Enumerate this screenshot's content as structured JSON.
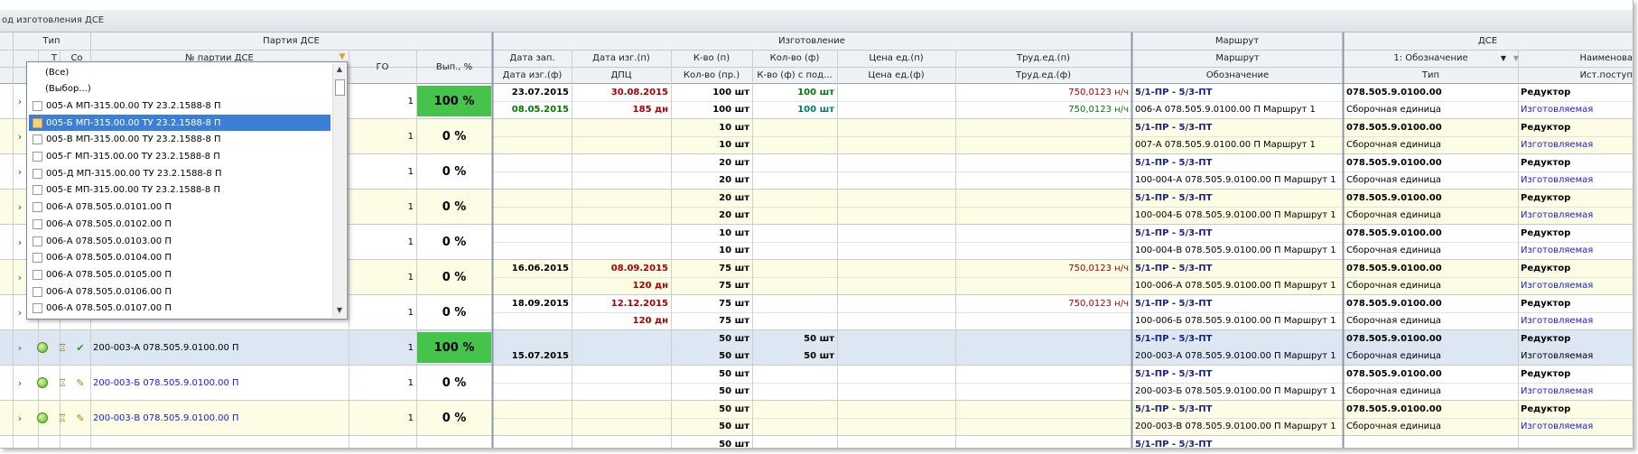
{
  "group_panel": {
    "text": "од изготовления ДСЕ"
  },
  "header": {
    "band_type": "Тип",
    "band_partiya": "Партия ДСЕ",
    "band_izg": "Изготовление",
    "band_marshrut": "Маршрут",
    "band_dse": "ДСЕ",
    "col_t": "Т",
    "col_so": "Со",
    "col_nomer": "№ партии ДСЕ",
    "col_go": "ГО",
    "col_vyp": "Вып., %",
    "r1": [
      "Дата зап.",
      "Дата изг.(п)",
      "К-во (п)",
      "Кол-во (ф)",
      "Цена ед.(п)",
      "Труд.ед.(п)",
      "Маршрут",
      "1: Обозначение",
      "Наименова"
    ],
    "r2": [
      "Дата изг.(ф)",
      "ДПЦ",
      "Кол-во (пр.)",
      "К-во (ф) с под...",
      "Цена ед.(ф)",
      "Труд.ед.(ф)",
      "Обозначение",
      "Тип",
      "Ист.поступ"
    ]
  },
  "dropdown": {
    "items": [
      "(Все)",
      "(Выбор...)",
      "005-А МП-315.00.00 ТУ 23.2.1588-8 П",
      "005-Б МП-315.00.00 ТУ 23.2.1588-8 П",
      "005-В МП-315.00.00 ТУ 23.2.1588-8 П",
      "005-Г МП-315.00.00 ТУ 23.2.1588-8 П",
      "005-Д МП-315.00.00 ТУ 23.2.1588-8 П",
      "005-Е МП-315.00.00 ТУ 23.2.1588-8 П",
      "006-А 078.505.0.0101.00 П",
      "006-А 078.505.0.0102.00 П",
      "006-А 078.505.0.0103.00 П",
      "006-А 078.505.0.0104.00 П",
      "006-А 078.505.0.0105.00 П",
      "006-А 078.505.0.0106.00 П",
      "006-А 078.505.0.0107.00 П"
    ],
    "selected_index": 3
  },
  "rows": [
    {
      "party": "",
      "go": "1",
      "vyp": "100 %",
      "done": true,
      "date_zap": "23.07.2015",
      "date_izg_p": "30.08.2015",
      "kvo_p": "100 шт",
      "kvo_f": "100 шт",
      "trud_p": "750,0123 н/ч",
      "marshrut": "5/1-ПР - 5/3-ПТ",
      "oboz": "078.505.9.0100.00",
      "naim": "Редуктор",
      "date_izg_f": "08.05.2015",
      "dpc": "185 дн",
      "kvo_pr": "100 шт",
      "kvo_fp": "100 шт",
      "trud_f": "750,0123 н/ч",
      "marshrut_oboz": "006-А 078.505.9.0100.00 П Маршрут 1",
      "tip": "Сборочная единица",
      "ist": "Изготовляемая"
    },
    {
      "party": "",
      "go": "1",
      "vyp": "0 %",
      "done": false,
      "date_zap": "",
      "date_izg_p": "",
      "kvo_p": "10 шт",
      "kvo_f": "",
      "trud_p": "",
      "marshrut": "5/1-ПР - 5/3-ПТ",
      "oboz": "078.505.9.0100.00",
      "naim": "Редуктор",
      "date_izg_f": "",
      "dpc": "",
      "kvo_pr": "10 шт",
      "kvo_fp": "",
      "trud_f": "",
      "marshrut_oboz": "007-А 078.505.9.0100.00 П Маршрут 1",
      "tip": "Сборочная единица",
      "ist": "Изготовляемая"
    },
    {
      "party": "",
      "go": "1",
      "vyp": "0 %",
      "done": false,
      "date_zap": "",
      "date_izg_p": "",
      "kvo_p": "20 шт",
      "kvo_f": "",
      "trud_p": "",
      "marshrut": "5/1-ПР - 5/3-ПТ",
      "oboz": "078.505.9.0100.00",
      "naim": "Редуктор",
      "date_izg_f": "",
      "dpc": "",
      "kvo_pr": "20 шт",
      "kvo_fp": "",
      "trud_f": "",
      "marshrut_oboz": "100-004-А 078.505.9.0100.00 П Маршрут 1",
      "tip": "Сборочная единица",
      "ist": "Изготовляемая"
    },
    {
      "party": "",
      "go": "1",
      "vyp": "0 %",
      "done": false,
      "date_zap": "",
      "date_izg_p": "",
      "kvo_p": "20 шт",
      "kvo_f": "",
      "trud_p": "",
      "marshrut": "5/1-ПР - 5/3-ПТ",
      "oboz": "078.505.9.0100.00",
      "naim": "Редуктор",
      "date_izg_f": "",
      "dpc": "",
      "kvo_pr": "20 шт",
      "kvo_fp": "",
      "trud_f": "",
      "marshrut_oboz": "100-004-Б 078.505.9.0100.00 П Маршрут 1",
      "tip": "Сборочная единица",
      "ist": "Изготовляемая"
    },
    {
      "party": "",
      "go": "1",
      "vyp": "0 %",
      "done": false,
      "date_zap": "",
      "date_izg_p": "",
      "kvo_p": "10 шт",
      "kvo_f": "",
      "trud_p": "",
      "marshrut": "5/1-ПР - 5/3-ПТ",
      "oboz": "078.505.9.0100.00",
      "naim": "Редуктор",
      "date_izg_f": "",
      "dpc": "",
      "kvo_pr": "10 шт",
      "kvo_fp": "",
      "trud_f": "",
      "marshrut_oboz": "100-004-В 078.505.9.0100.00 П Маршрут 1",
      "tip": "Сборочная единица",
      "ist": "Изготовляемая"
    },
    {
      "party": "",
      "go": "1",
      "vyp": "0 %",
      "done": false,
      "date_zap": "16.06.2015",
      "date_izg_p": "08.09.2015",
      "kvo_p": "75 шт",
      "kvo_f": "",
      "trud_p": "750,0123 н/ч",
      "marshrut": "5/1-ПР - 5/3-ПТ",
      "oboz": "078.505.9.0100.00",
      "naim": "Редуктор",
      "date_izg_f": "",
      "dpc": "120 дн",
      "kvo_pr": "75 шт",
      "kvo_fp": "",
      "trud_f": "",
      "marshrut_oboz": "100-006-А 078.505.9.0100.00 П Маршрут 1",
      "tip": "Сборочная единица",
      "ist": "Изготовляемая"
    },
    {
      "party": "",
      "go": "1",
      "vyp": "0 %",
      "done": false,
      "date_zap": "18.09.2015",
      "date_izg_p": "12.12.2015",
      "kvo_p": "75 шт",
      "kvo_f": "",
      "trud_p": "750,0123 н/ч",
      "marshrut": "5/1-ПР - 5/3-ПТ",
      "oboz": "078.505.9.0100.00",
      "naim": "Редуктор",
      "date_izg_f": "",
      "dpc": "120 дн",
      "kvo_pr": "75 шт",
      "kvo_fp": "",
      "trud_f": "",
      "marshrut_oboz": "100-006-Б 078.505.9.0100.00 П Маршрут 1",
      "tip": "Сборочная единица",
      "ist": "Изготовляемая"
    },
    {
      "party": "200-003-А 078.505.9.0100.00 П",
      "go": "1",
      "vyp": "100 %",
      "done": true,
      "date_zap": "",
      "date_izg_p": "",
      "kvo_p": "50 шт",
      "kvo_f": "50 шт",
      "trud_p": "",
      "marshrut": "5/1-ПР - 5/3-ПТ",
      "oboz": "078.505.9.0100.00",
      "naim": "Редуктор",
      "date_izg_f": "15.07.2015",
      "dpc": "",
      "kvo_pr": "50 шт",
      "kvo_fp": "50 шт",
      "trud_f": "",
      "marshrut_oboz": "200-003-А 078.505.9.0100.00 П Маршрут 1",
      "tip": "Сборочная единица",
      "ist": "Изготовляемая"
    },
    {
      "party": "200-003-Б 078.505.9.0100.00 П",
      "go": "1",
      "vyp": "0 %",
      "done": false,
      "date_zap": "",
      "date_izg_p": "",
      "kvo_p": "50 шт",
      "kvo_f": "",
      "trud_p": "",
      "marshrut": "5/1-ПР - 5/3-ПТ",
      "oboz": "078.505.9.0100.00",
      "naim": "Редуктор",
      "date_izg_f": "",
      "dpc": "",
      "kvo_pr": "50 шт",
      "kvo_fp": "",
      "trud_f": "",
      "marshrut_oboz": "200-003-Б 078.505.9.0100.00 П Маршрут 1",
      "tip": "Сборочная единица",
      "ist": "Изготовляемая"
    },
    {
      "party": "200-003-В 078.505.9.0100.00 П",
      "go": "1",
      "vyp": "0 %",
      "done": false,
      "date_zap": "",
      "date_izg_p": "",
      "kvo_p": "50 шт",
      "kvo_f": "",
      "trud_p": "",
      "marshrut": "5/1-ПР - 5/3-ПТ",
      "oboz": "078.505.9.0100.00",
      "naim": "Редуктор",
      "date_izg_f": "",
      "dpc": "",
      "kvo_pr": "50 шт",
      "kvo_fp": "",
      "trud_f": "",
      "marshrut_oboz": "200-003-В 078.505.9.0100.00 П Маршрут 1",
      "tip": "Сборочная единица",
      "ist": "Изготовляемая"
    },
    {
      "party": "",
      "go": "",
      "vyp": "",
      "done": false,
      "date_zap": "",
      "date_izg_p": "",
      "kvo_p": "50 шт",
      "kvo_f": "",
      "trud_p": "",
      "marshrut": "5/1-ПР - 5/3-ПТ",
      "oboz": "",
      "naim": "",
      "date_izg_f": "",
      "dpc": "",
      "kvo_pr": "",
      "kvo_fp": "",
      "trud_f": "",
      "marshrut_oboz": "",
      "tip": "",
      "ist": ""
    }
  ],
  "colors": {
    "row_alt": "#fdfde6",
    "row_sel": "#dde7f4",
    "bar_green": "#45c34a",
    "header_bg": "#eef1f5",
    "select_blue": "#3c7fd9"
  }
}
